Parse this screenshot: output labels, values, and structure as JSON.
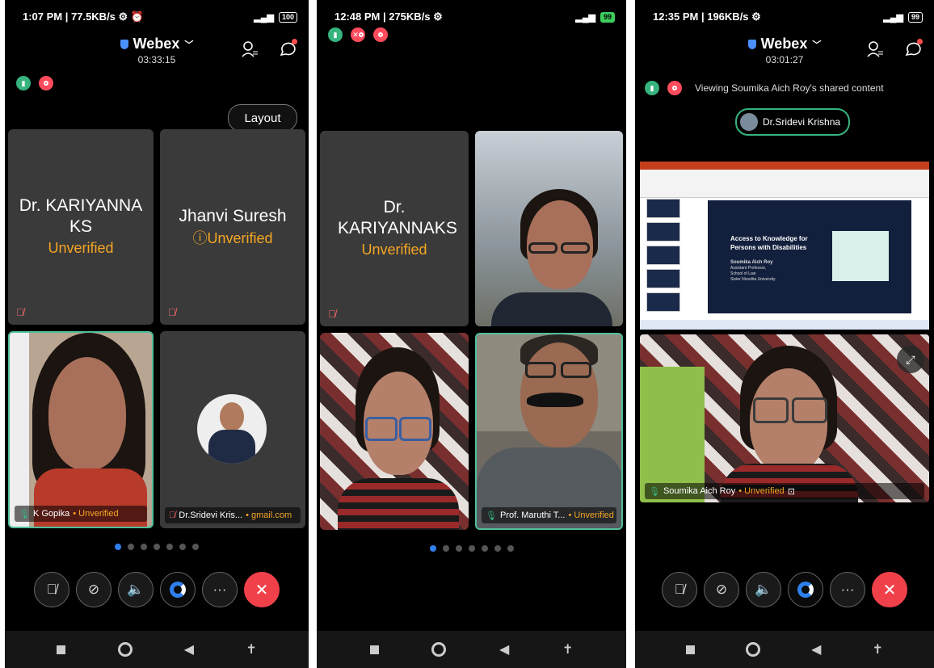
{
  "panel1": {
    "status": {
      "left": "1:07 PM | 77.5KB/s ⚙ ⏰",
      "battery": "100"
    },
    "app_title": "Webex",
    "timer": "03:33:15",
    "layout_label": "Layout",
    "tiles": [
      {
        "name": "Dr. KARIYANNA KS",
        "status": "Unverified"
      },
      {
        "name": "Jhanvi Suresh",
        "status": "Unverified"
      }
    ],
    "video_tiles": [
      {
        "name": "K Gopika",
        "status": "Unverified"
      },
      {
        "name": "Dr.Sridevi Kris...",
        "domain": "gmail.com"
      }
    ]
  },
  "panel2": {
    "status": {
      "left": "12:48 PM | 275KB/s ⚙",
      "battery": "99"
    },
    "tiles": [
      {
        "name": "Dr. KARIYANNAKS",
        "status": "Unverified"
      }
    ],
    "video_tiles": [
      {
        "name": "Prof. Maruthi T...",
        "status": "Unverified"
      }
    ]
  },
  "panel3": {
    "status": {
      "left": "12:35 PM | 196KB/s ⚙",
      "battery": "99"
    },
    "app_title": "Webex",
    "timer": "03:01:27",
    "sharing_text": "Viewing Soumika Aich Roy's shared content",
    "presenter_pill": "Dr.Sridevi Krishna",
    "slide": {
      "title": "Access to Knowledge for Persons with Disabilities",
      "author": "Soumika Aich Roy",
      "role": "Assistant Professor,",
      "school": "School of Law",
      "university": "Sister Nivedita University"
    },
    "video_label": {
      "name": "Soumika Aich Roy",
      "status": "Unverified"
    }
  },
  "controls": {
    "mute": "🎤",
    "video": "📹",
    "speaker": "🔊",
    "webex": "",
    "more": "···",
    "end": "✕"
  },
  "nav": {
    "back": "◀",
    "access": "✝"
  }
}
